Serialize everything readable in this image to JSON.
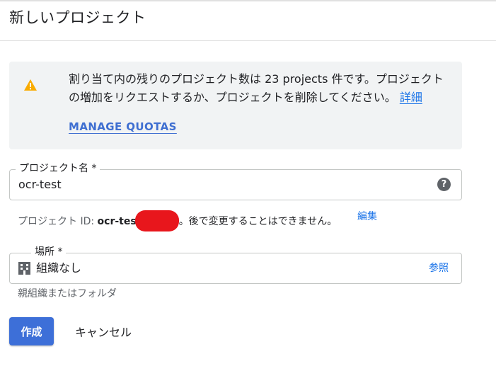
{
  "page": {
    "title": "新しいプロジェクト"
  },
  "quota_banner": {
    "message": "割り当て内の残りのプロジェクト数は 23 projects 件です。プロジェクトの増加をリクエストするか、プロジェクトを削除してください。",
    "details_link": "詳細",
    "manage_quotas_label": "MANAGE QUOTAS",
    "icon": "warning-icon",
    "icon_color": "#f9ab00"
  },
  "project_name": {
    "label": "プロジェクト名 *",
    "value": "ocr-test",
    "help_icon": "help-icon"
  },
  "project_id": {
    "prefix": "プロジェクト ID: ",
    "value": "ocr-tes",
    "suffix": "。後で変更することはできません。",
    "edit_link": "編集"
  },
  "location": {
    "label": "場所 *",
    "value": "組織なし",
    "browse_link": "参照",
    "helper": "親組織またはフォルダ",
    "icon": "building-icon"
  },
  "actions": {
    "create_label": "作成",
    "cancel_label": "キャンセル",
    "primary_color": "#3d6fd8"
  }
}
